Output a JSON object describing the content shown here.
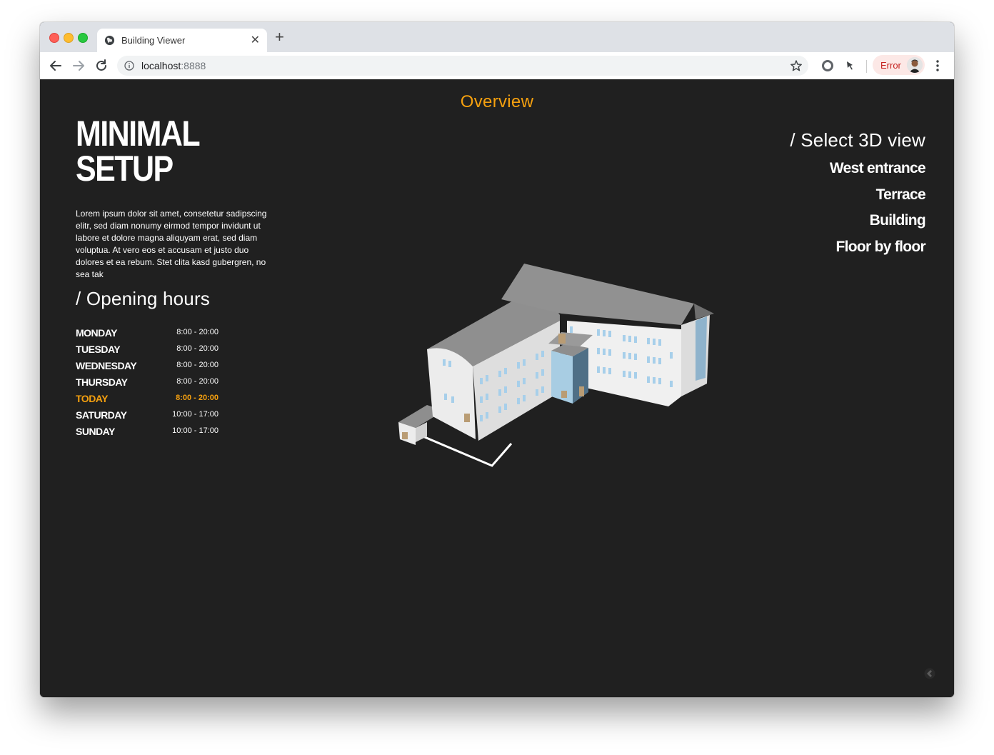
{
  "browser": {
    "tab_title": "Building Viewer",
    "new_tab_symbol": "+",
    "tab_close_symbol": "✕",
    "url_host": "localhost",
    "url_port": ":8888",
    "profile_status": "Error",
    "icons": [
      "globe-icon",
      "back-icon",
      "forward-icon",
      "reload-icon",
      "info-icon",
      "star-icon",
      "extension-icon",
      "pin-icon",
      "avatar",
      "menu-icon"
    ]
  },
  "page": {
    "header": "Overview",
    "title_line1": "MINIMAL",
    "title_line2": "SETUP",
    "description": "Lorem ipsum dolor sit amet, consetetur sadipscing elitr, sed diam nonumy eirmod tempor invidunt ut labore et dolore magna aliquyam erat, sed diam voluptua. At vero eos et accusam et justo duo dolores et ea rebum. Stet clita kasd gubergren, no sea tak",
    "opening_hours_heading": "/  Opening hours",
    "opening_hours": [
      {
        "day": "MONDAY",
        "time": "8:00 - 20:00"
      },
      {
        "day": "TUESDAY",
        "time": "8:00 - 20:00"
      },
      {
        "day": "WEDNESDAY",
        "time": "8:00 - 20:00"
      },
      {
        "day": "THURSDAY",
        "time": "8:00 - 20:00"
      },
      {
        "day": "TODAY",
        "time": "8:00 - 20:00",
        "highlight": true
      },
      {
        "day": "SATURDAY",
        "time": "10:00 - 17:00"
      },
      {
        "day": "SUNDAY",
        "time": "10:00 - 17:00"
      }
    ],
    "select_view_heading": "/  Select 3D view",
    "views": [
      "West entrance",
      "Terrace",
      "Building",
      "Floor by floor"
    ]
  },
  "colors": {
    "accent": "#f5a00f",
    "background": "#202020",
    "text": "#ffffff"
  }
}
